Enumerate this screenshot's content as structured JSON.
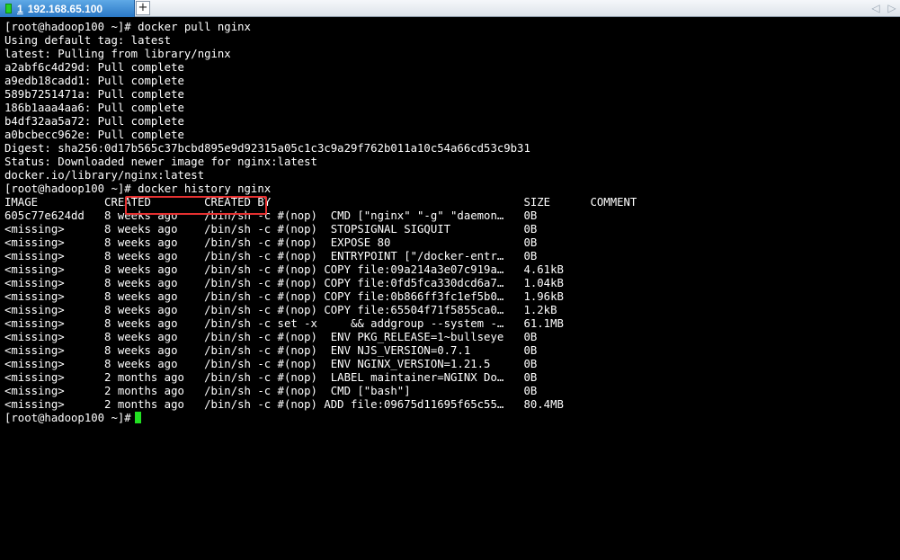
{
  "tab": {
    "number": "1",
    "host": "192.168.65.100",
    "status_color": "#25d025"
  },
  "tabbar": {
    "new_tab_label": "+",
    "prev_label": "◁",
    "next_label": "▷"
  },
  "terminal": {
    "lines": [
      "[root@hadoop100 ~]# docker pull nginx",
      "Using default tag: latest",
      "latest: Pulling from library/nginx",
      "a2abf6c4d29d: Pull complete",
      "a9edb18cadd1: Pull complete",
      "589b7251471a: Pull complete",
      "186b1aaa4aa6: Pull complete",
      "b4df32aa5a72: Pull complete",
      "a0bcbecc962e: Pull complete",
      "Digest: sha256:0d17b565c37bcbd895e9d92315a05c1c3c9a29f762b011a10c54a66cd53c9b31",
      "Status: Downloaded newer image for nginx:latest",
      "docker.io/library/nginx:latest"
    ],
    "prompt": "[root@hadoop100 ~]#",
    "highlighted_command": "docker history nginx",
    "table": [
      "IMAGE          CREATED        CREATED BY                                      SIZE      COMMENT",
      "605c77e624dd   8 weeks ago    /bin/sh -c #(nop)  CMD [\"nginx\" \"-g\" \"daemon…   0B",
      "<missing>      8 weeks ago    /bin/sh -c #(nop)  STOPSIGNAL SIGQUIT           0B",
      "<missing>      8 weeks ago    /bin/sh -c #(nop)  EXPOSE 80                    0B",
      "<missing>      8 weeks ago    /bin/sh -c #(nop)  ENTRYPOINT [\"/docker-entr…   0B",
      "<missing>      8 weeks ago    /bin/sh -c #(nop) COPY file:09a214a3e07c919a…   4.61kB",
      "<missing>      8 weeks ago    /bin/sh -c #(nop) COPY file:0fd5fca330dcd6a7…   1.04kB",
      "<missing>      8 weeks ago    /bin/sh -c #(nop) COPY file:0b866ff3fc1ef5b0…   1.96kB",
      "<missing>      8 weeks ago    /bin/sh -c #(nop) COPY file:65504f71f5855ca0…   1.2kB",
      "<missing>      8 weeks ago    /bin/sh -c set -x     && addgroup --system -…   61.1MB",
      "<missing>      8 weeks ago    /bin/sh -c #(nop)  ENV PKG_RELEASE=1~bullseye   0B",
      "<missing>      8 weeks ago    /bin/sh -c #(nop)  ENV NJS_VERSION=0.7.1        0B",
      "<missing>      8 weeks ago    /bin/sh -c #(nop)  ENV NGINX_VERSION=1.21.5     0B",
      "<missing>      2 months ago   /bin/sh -c #(nop)  LABEL maintainer=NGINX Do…   0B",
      "<missing>      2 months ago   /bin/sh -c #(nop)  CMD [\"bash\"]                 0B",
      "<missing>      2 months ago   /bin/sh -c #(nop) ADD file:09675d11695f65c55…   80.4MB"
    ],
    "final_prompt": "[root@hadoop100 ~]#",
    "cursor_color": "#22e022",
    "highlight_color": "#e53030"
  }
}
